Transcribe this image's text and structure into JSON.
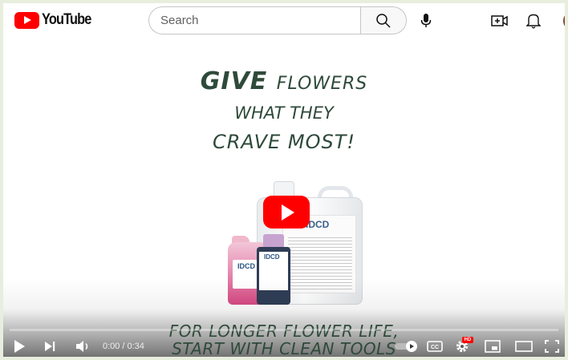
{
  "header": {
    "logo_text": "YouTube",
    "search_placeholder": "Search"
  },
  "video": {
    "headline": {
      "line1_big": "GIVE",
      "line1_small": "FLOWERS",
      "line2": "WHAT THEY",
      "line3": "CRAVE MOST!"
    },
    "bottom_line": {
      "line1": "FOR LONGER FLOWER LIFE,",
      "line2": "START WITH CLEAN TOOLS"
    },
    "product_brand": "IDCD"
  },
  "player": {
    "current_time": "0:00",
    "separator": "/",
    "duration": "0:34",
    "progress": 0.0,
    "hd_badge": "HD",
    "cc_label": "CC"
  },
  "colors": {
    "brand_red": "#ff0000",
    "headline_green": "#2e4a3a",
    "frame_bg": "#e8eedd"
  },
  "icons": [
    "youtube-logo-icon",
    "search-icon",
    "microphone-icon",
    "create-video-icon",
    "bell-icon",
    "play-icon",
    "next-icon",
    "volume-icon",
    "autoplay-toggle-icon",
    "captions-icon",
    "settings-icon",
    "miniplayer-icon",
    "theater-icon",
    "fullscreen-icon"
  ]
}
